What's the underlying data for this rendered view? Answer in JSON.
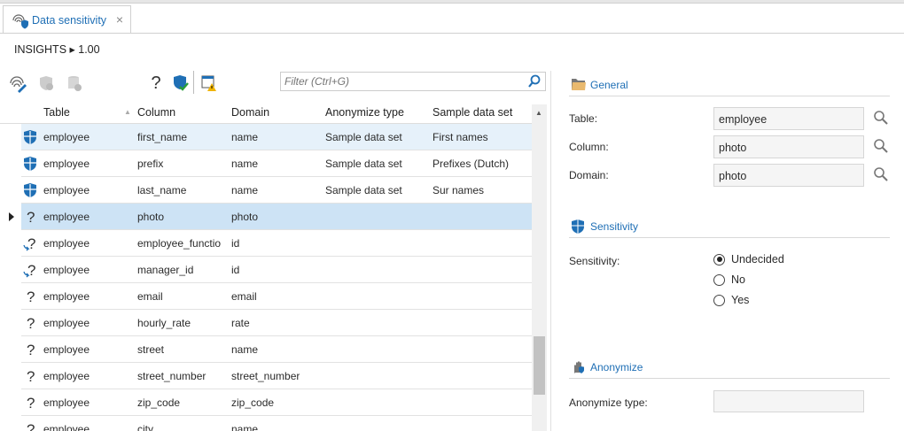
{
  "tab": {
    "label": "Data sensitivity",
    "close": "×"
  },
  "breadcrumb": "INSIGHTS ▸ 1.00",
  "toolbar": {
    "help": "?",
    "filter_placeholder": "Filter (Ctrl+G)"
  },
  "grid": {
    "headers": [
      "Table",
      "Column",
      "Domain",
      "Anonymize type",
      "Sample data set"
    ],
    "rows": [
      {
        "icon": "shield",
        "table": "employee",
        "column": "first_name",
        "domain": "name",
        "anon": "Sample data set",
        "sample": "First names"
      },
      {
        "icon": "shield",
        "table": "employee",
        "column": "prefix",
        "domain": "name",
        "anon": "Sample data set",
        "sample": "Prefixes (Dutch)"
      },
      {
        "icon": "shield",
        "table": "employee",
        "column": "last_name",
        "domain": "name",
        "anon": "Sample data set",
        "sample": "Sur names"
      },
      {
        "icon": "question",
        "table": "employee",
        "column": "photo",
        "domain": "photo",
        "anon": "",
        "sample": ""
      },
      {
        "icon": "question-link",
        "table": "employee",
        "column": "employee_functio",
        "domain": "id",
        "anon": "",
        "sample": ""
      },
      {
        "icon": "question-link",
        "table": "employee",
        "column": "manager_id",
        "domain": "id",
        "anon": "",
        "sample": ""
      },
      {
        "icon": "question",
        "table": "employee",
        "column": "email",
        "domain": "email",
        "anon": "",
        "sample": ""
      },
      {
        "icon": "question",
        "table": "employee",
        "column": "hourly_rate",
        "domain": "rate",
        "anon": "",
        "sample": ""
      },
      {
        "icon": "question",
        "table": "employee",
        "column": "street",
        "domain": "name",
        "anon": "",
        "sample": ""
      },
      {
        "icon": "question",
        "table": "employee",
        "column": "street_number",
        "domain": "street_number",
        "anon": "",
        "sample": ""
      },
      {
        "icon": "question",
        "table": "employee",
        "column": "zip_code",
        "domain": "zip_code",
        "anon": "",
        "sample": ""
      },
      {
        "icon": "question",
        "table": "employee",
        "column": "city",
        "domain": "name",
        "anon": "",
        "sample": ""
      }
    ]
  },
  "details": {
    "general": {
      "title": "General",
      "table_label": "Table:",
      "table_value": "employee",
      "column_label": "Column:",
      "column_value": "photo",
      "domain_label": "Domain:",
      "domain_value": "photo"
    },
    "sensitivity": {
      "title": "Sensitivity",
      "label": "Sensitivity:",
      "options": [
        "Undecided",
        "No",
        "Yes"
      ],
      "selected": "Undecided"
    },
    "anonymize": {
      "title": "Anonymize",
      "type_label": "Anonymize type:",
      "type_value": ""
    }
  },
  "colors": {
    "accent": "#1f6fb5",
    "selected_row": "#cde3f5",
    "hover_row": "#e6f1fa"
  }
}
